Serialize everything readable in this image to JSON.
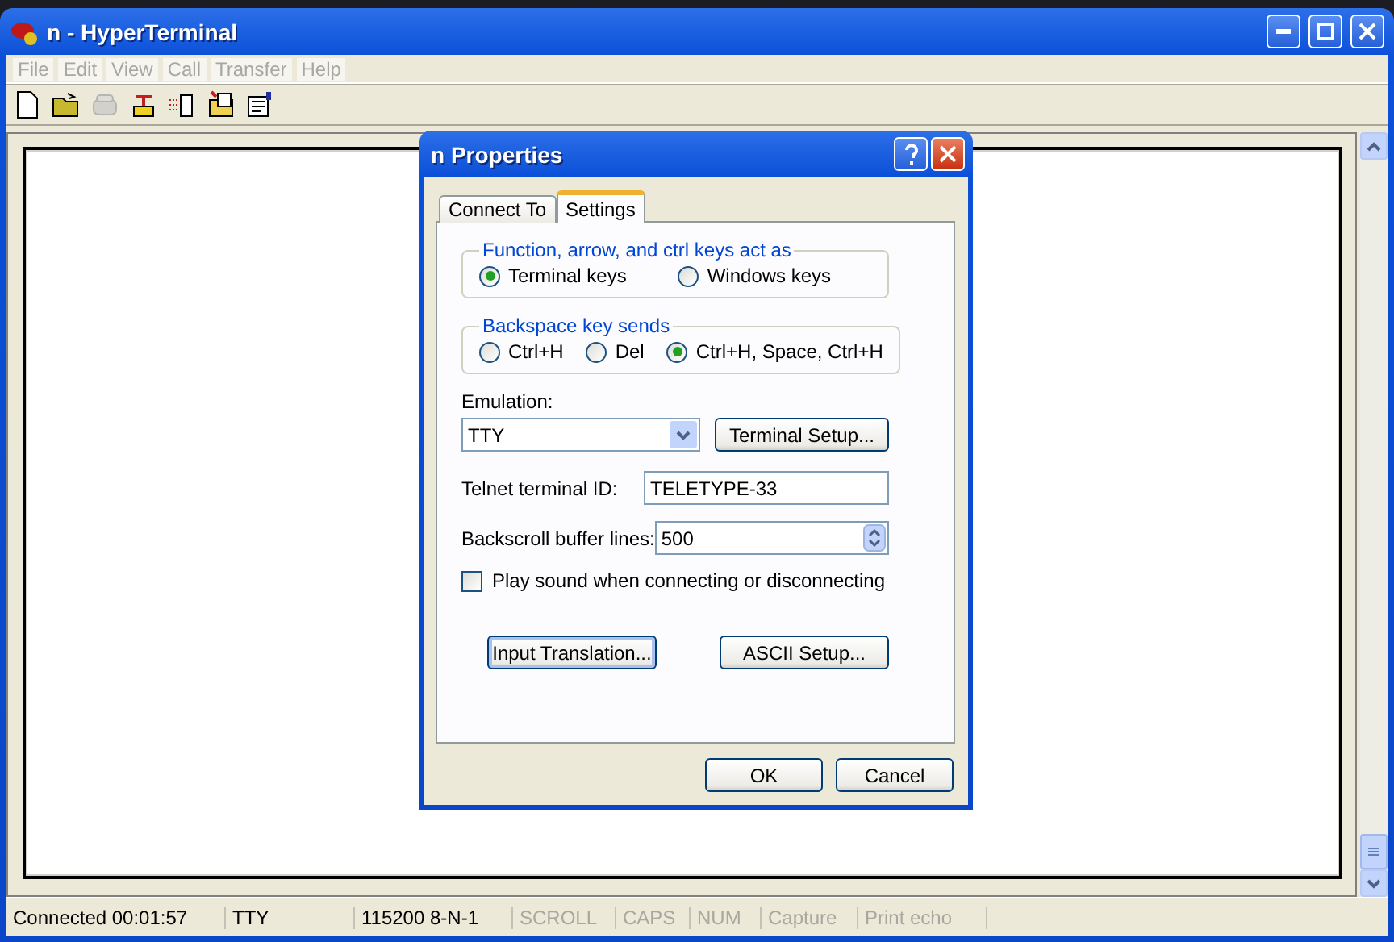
{
  "window": {
    "title": "n - HyperTerminal"
  },
  "menu": [
    {
      "label": "File",
      "disabled": true
    },
    {
      "label": "Edit",
      "disabled": true
    },
    {
      "label": "View",
      "disabled": true
    },
    {
      "label": "Call",
      "disabled": true
    },
    {
      "label": "Transfer",
      "disabled": true
    },
    {
      "label": "Help",
      "disabled": true
    }
  ],
  "toolbar": [
    {
      "kind": "new",
      "disabled": false
    },
    {
      "kind": "open",
      "disabled": false
    },
    {
      "kind": "call",
      "disabled": true
    },
    {
      "kind": "disconnect",
      "disabled": false
    },
    {
      "kind": "send",
      "disabled": false
    },
    {
      "kind": "receive",
      "disabled": false
    },
    {
      "kind": "properties",
      "disabled": false
    }
  ],
  "dialog": {
    "title": "n Properties",
    "tabs": [
      {
        "label": "Connect To",
        "selected": false
      },
      {
        "label": "Settings",
        "selected": true
      }
    ],
    "keys_group": {
      "legend": "Function, arrow, and ctrl keys act as",
      "options": [
        {
          "label": "Terminal keys",
          "selected": true
        },
        {
          "label": "Windows keys",
          "selected": false
        }
      ]
    },
    "backspace_group": {
      "legend": "Backspace key sends",
      "options": [
        {
          "label": "Ctrl+H",
          "selected": false
        },
        {
          "label": "Del",
          "selected": false
        },
        {
          "label": "Ctrl+H, Space, Ctrl+H",
          "selected": true
        }
      ]
    },
    "emulation": {
      "label": "Emulation:",
      "value": "TTY",
      "button": "Terminal Setup..."
    },
    "telnet": {
      "label": "Telnet terminal ID:",
      "value": "TELETYPE-33"
    },
    "backscroll": {
      "label": "Backscroll buffer lines:",
      "value": "500"
    },
    "sound": {
      "label": "Play sound when connecting or disconnecting",
      "checked": false
    },
    "buttons": [
      "Input Translation...",
      "ASCII Setup..."
    ],
    "footer_buttons": [
      "OK",
      "Cancel"
    ]
  },
  "status_bar": [
    {
      "text": "Connected 00:01:57",
      "disabled": false
    },
    {
      "text": "TTY",
      "disabled": false
    },
    {
      "text": "115200 8-N-1",
      "disabled": false
    },
    {
      "text": "SCROLL",
      "disabled": true
    },
    {
      "text": "CAPS",
      "disabled": true
    },
    {
      "text": "NUM",
      "disabled": true
    },
    {
      "text": "Capture",
      "disabled": true
    },
    {
      "text": "Print echo",
      "disabled": true
    }
  ]
}
